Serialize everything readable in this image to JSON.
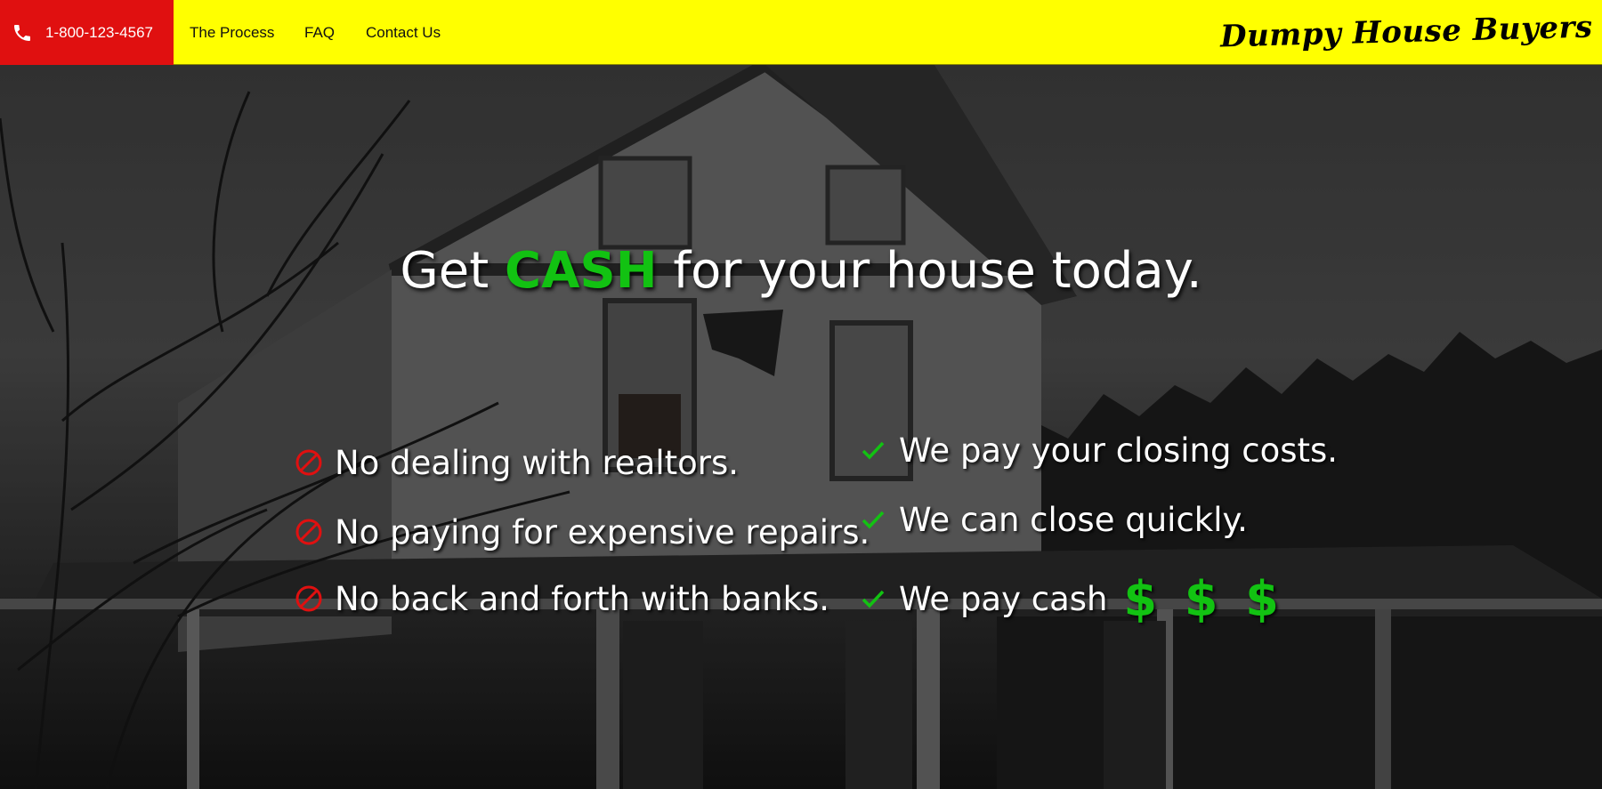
{
  "nav": {
    "phone": "1-800-123-4567",
    "links": [
      "The Process",
      "FAQ",
      "Contact Us"
    ],
    "brand": "Dumpy House Buyers"
  },
  "hero": {
    "headline_pre": "Get",
    "headline_highlight": "CASH",
    "headline_post": "for your house today.",
    "cons": [
      "No dealing with realtors.",
      "No paying for expensive repairs.",
      "No back and forth with banks."
    ],
    "pros": [
      "We pay your closing costs.",
      "We can close quickly.",
      "We pay cash"
    ],
    "dollars": "$ $ $"
  },
  "colors": {
    "nav_background": "#ffff00",
    "phone_background": "#e01010",
    "cash_green": "#12c212",
    "no_icon_red": "#e01010",
    "check_green": "#12c212"
  },
  "icons": {
    "phone": "phone-icon",
    "cons": "no-symbol-icon",
    "pros": "checkmark-icon"
  }
}
